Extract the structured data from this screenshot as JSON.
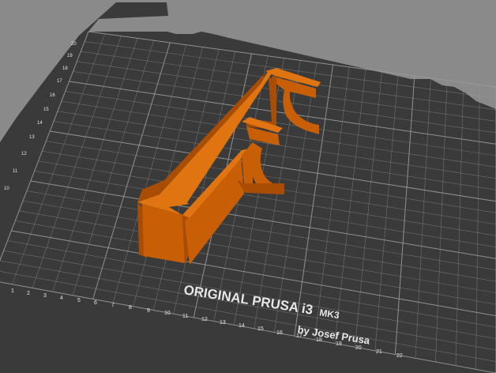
{
  "viewport": {
    "background": "#8a8a8a"
  },
  "bed": {
    "surface_color": "#3a3a3a",
    "grid_color": "#9a9a9a",
    "label_color": "#e6e6e6",
    "branding_line1": "ORIGINAL PRUSA i3",
    "branding_model": "MK3",
    "branding_line2": "by Josef Prusa",
    "left_axis_labels": [
      "10",
      "11",
      "12",
      "13",
      "14",
      "15",
      "16",
      "17",
      "18",
      "19",
      "20"
    ],
    "bottom_axis_labels": [
      "1",
      "2",
      "3",
      "4",
      "5",
      "6",
      "7",
      "8",
      "9",
      "10",
      "11",
      "12",
      "13",
      "14",
      "15",
      "16",
      "17",
      "18",
      "19",
      "20",
      "21",
      "22"
    ]
  },
  "model": {
    "name": "",
    "color_top": "#e07410",
    "color_front": "#c85f06",
    "color_side": "#a84d03"
  }
}
